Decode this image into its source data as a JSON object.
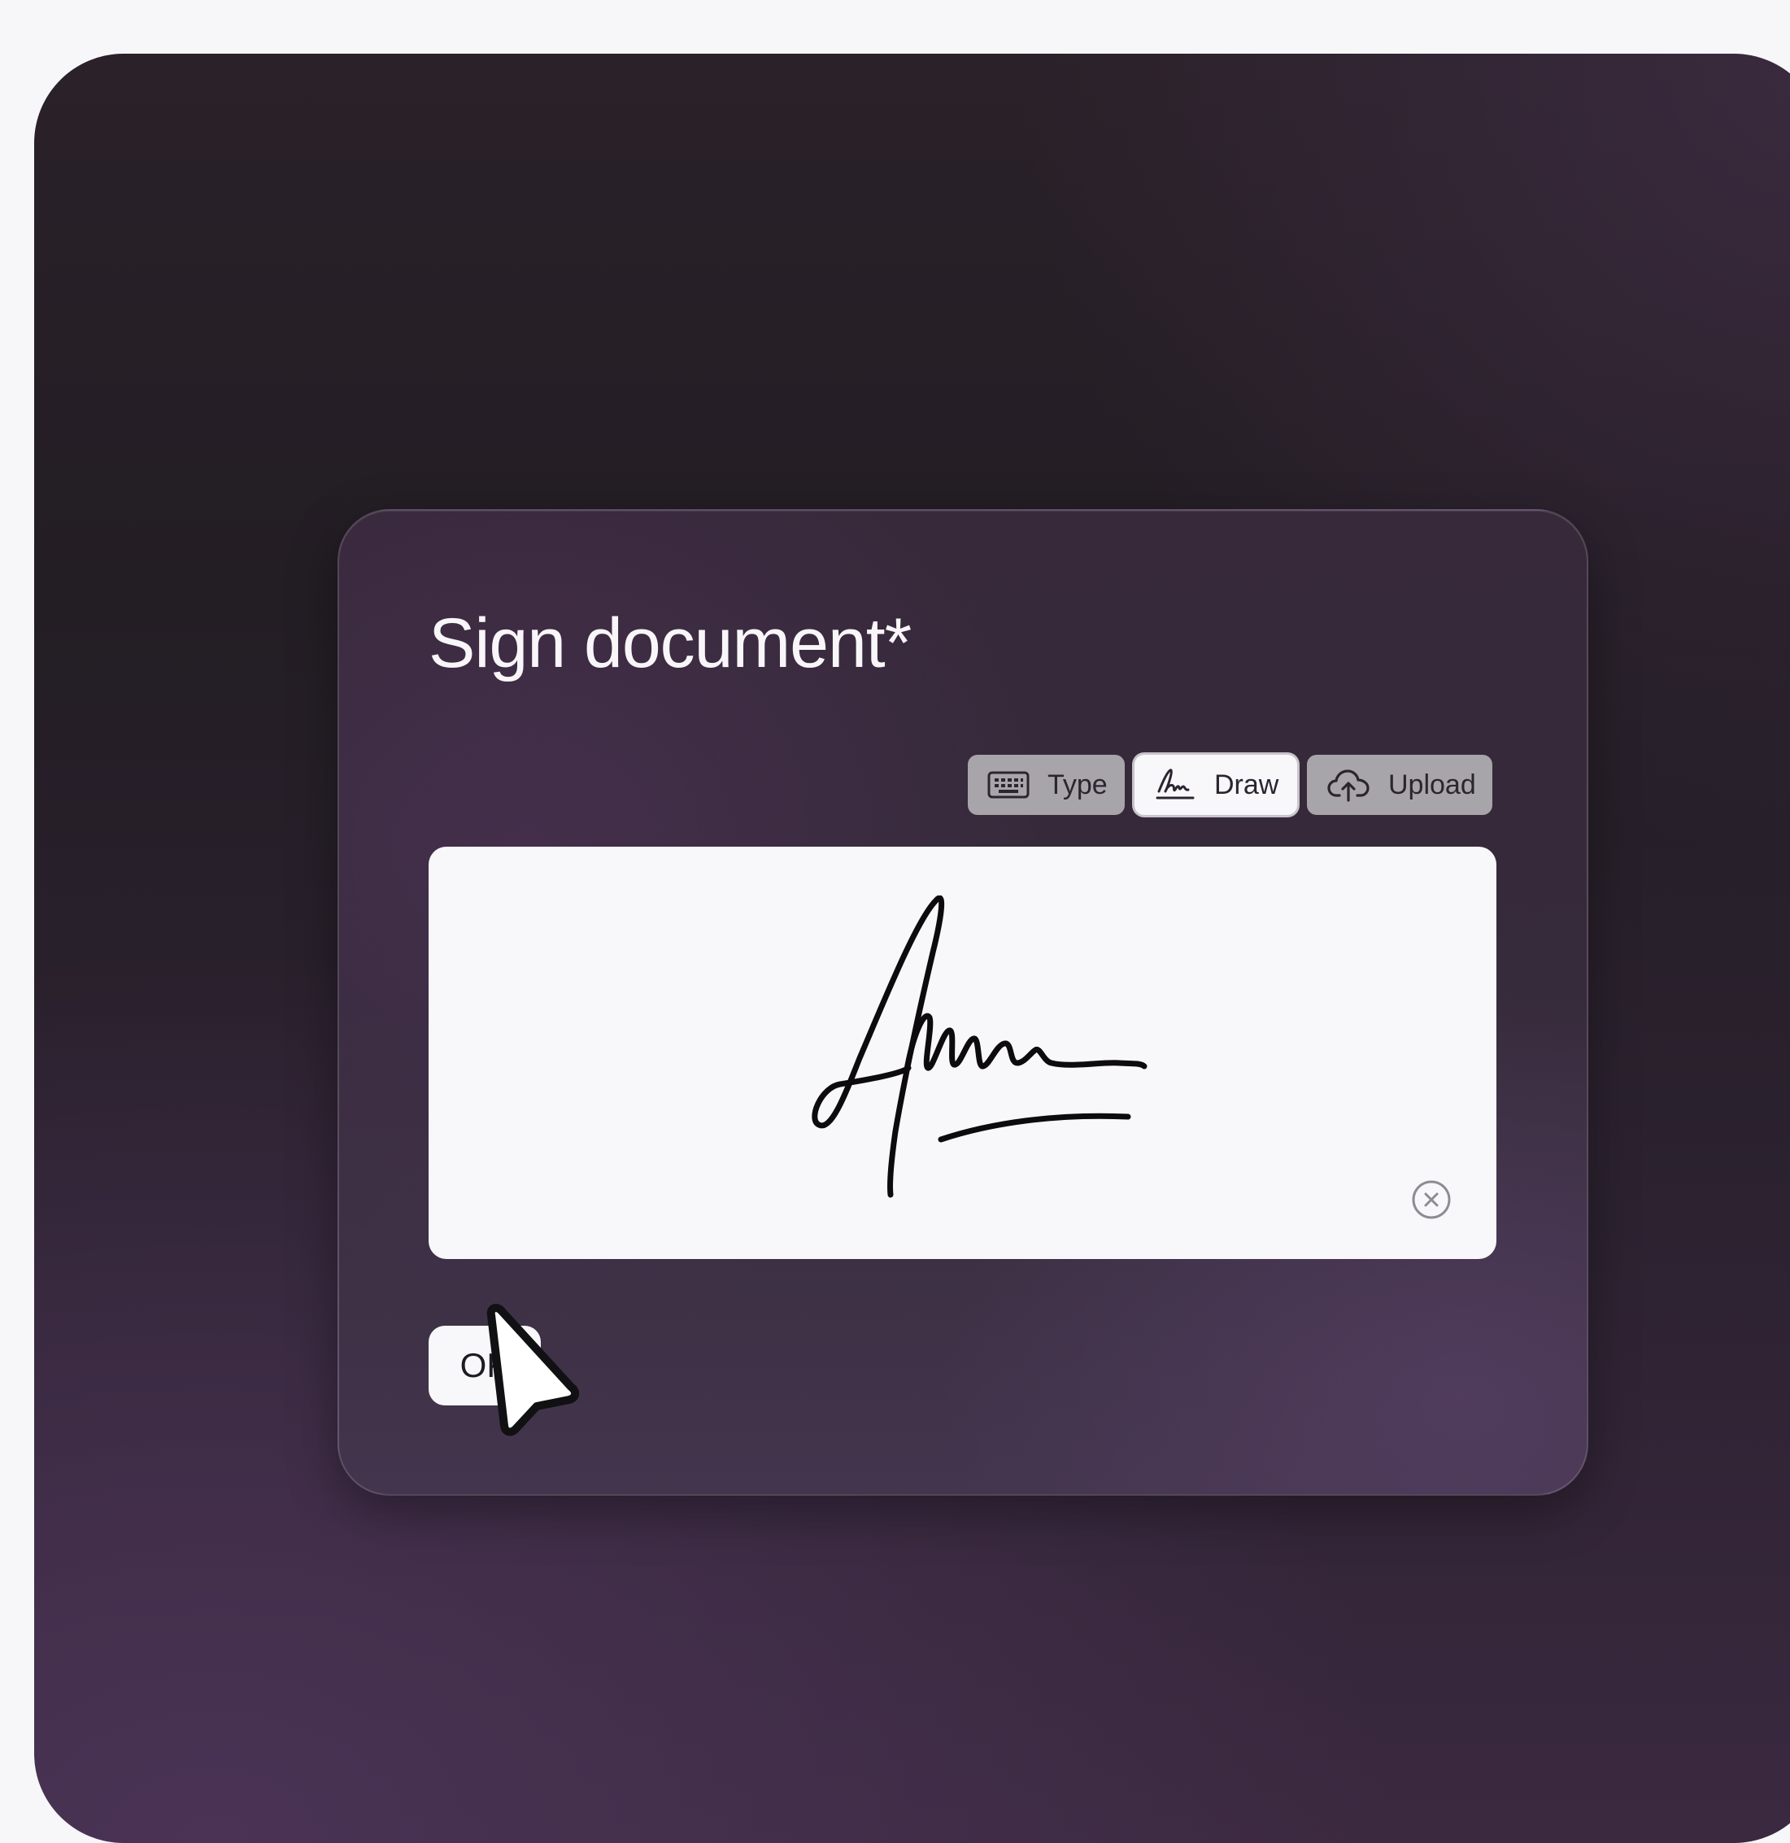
{
  "dialog": {
    "title": "Sign document*"
  },
  "tabs": [
    {
      "label": "Type",
      "icon": "keyboard-icon",
      "active": false
    },
    {
      "label": "Draw",
      "icon": "signature-icon",
      "active": true
    },
    {
      "label": "Upload",
      "icon": "cloud-upload-icon",
      "active": false
    }
  ],
  "canvas": {
    "clear_icon": "close-circle-icon"
  },
  "actions": {
    "ok_label": "OK"
  },
  "colors": {
    "background": "#241d25",
    "card": "#362b3a",
    "tab_inactive": "#a8a5aa",
    "tab_active": "#f8f7f9",
    "canvas": "#f8f8fa"
  }
}
